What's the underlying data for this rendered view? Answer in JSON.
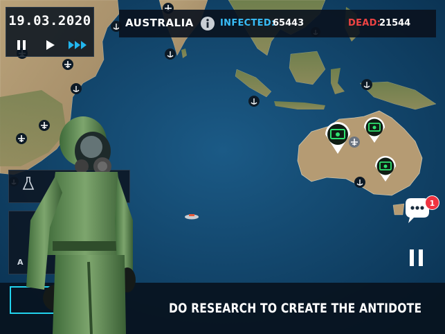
{
  "date": "19.03.2020",
  "controls": {
    "pause": "pause-icon",
    "play": "play-icon",
    "fast_forward": "fast-forward-icon"
  },
  "stats_bar": {
    "country": "AUSTRALIA",
    "infected_label": "INFECTED:",
    "infected_value": "65443",
    "dead_label": "DEAD:",
    "dead_value": "21544"
  },
  "colors": {
    "infected": "#38bdf8",
    "dead": "#ef4444",
    "accent": "#22d3ee",
    "money_green": "#2ee36f",
    "badge": "#ef3340"
  },
  "panel": {
    "partial_text": "A",
    "icon": "flask-icon"
  },
  "bottom": {
    "instruction": "DO RESEARCH TO CREATE THE ANTIDOTE"
  },
  "notifications": {
    "count": "1",
    "icon": "chat-bubble-icon"
  },
  "map_icons": {
    "airport": "plane-icon",
    "port": "anchor-icon",
    "money": "money-pin-icon"
  }
}
